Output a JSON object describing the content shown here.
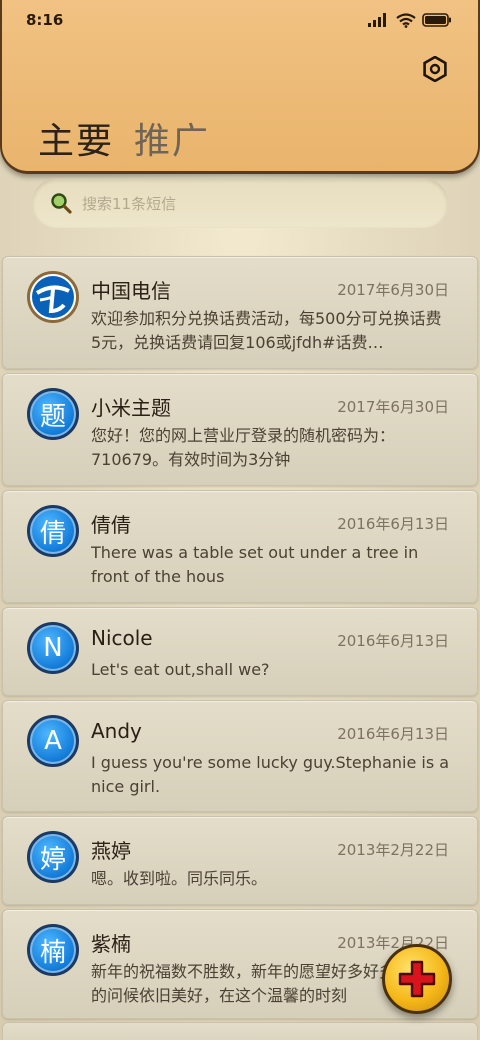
{
  "status_bar": {
    "time": "8:16"
  },
  "tabs": [
    "主要",
    "推广"
  ],
  "search": {
    "placeholder": "搜索11条短信"
  },
  "messages": [
    {
      "avatar": "",
      "avatar_icon": "china-telecom-logo-icon",
      "name": "中国电信",
      "date": "2017年6月30日",
      "text": "欢迎参加积分兑换话费活动，每500分可兑换话费5元，兑换话费请回复106或jfdh#话费…"
    },
    {
      "avatar": "题",
      "name": "小米主题",
      "date": "2017年6月30日",
      "text": "您好！您的网上营业厅登录的随机密码为：710679。有效时间为3分钟"
    },
    {
      "avatar": "倩",
      "name": "倩倩",
      "date": "2016年6月13日",
      "text": "There was a table set out under a tree in front of the hous"
    },
    {
      "avatar": "N",
      "name": "Nicole",
      "date": "2016年6月13日",
      "text": "Let's eat out,shall we?"
    },
    {
      "avatar": "A",
      "name": "Andy",
      "date": "2016年6月13日",
      "text": "I guess you're some lucky guy.Stephanie is a nice girl."
    },
    {
      "avatar": "婷",
      "name": "燕婷",
      "date": "2013年2月22日",
      "text": "嗯。收到啦。同乐同乐。"
    },
    {
      "avatar": "楠",
      "name": "紫楠",
      "date": "2013年2月22日",
      "text": "新年的祝福数不胜数，新年的愿望好多好多，新年的问候依旧美好，在这个温馨的时刻"
    }
  ],
  "colors": {
    "header": "#eab46c",
    "avatar_blue": "#0f78d6",
    "fab_gold": "#f5b81a",
    "fab_plus_red": "#d8141c"
  }
}
